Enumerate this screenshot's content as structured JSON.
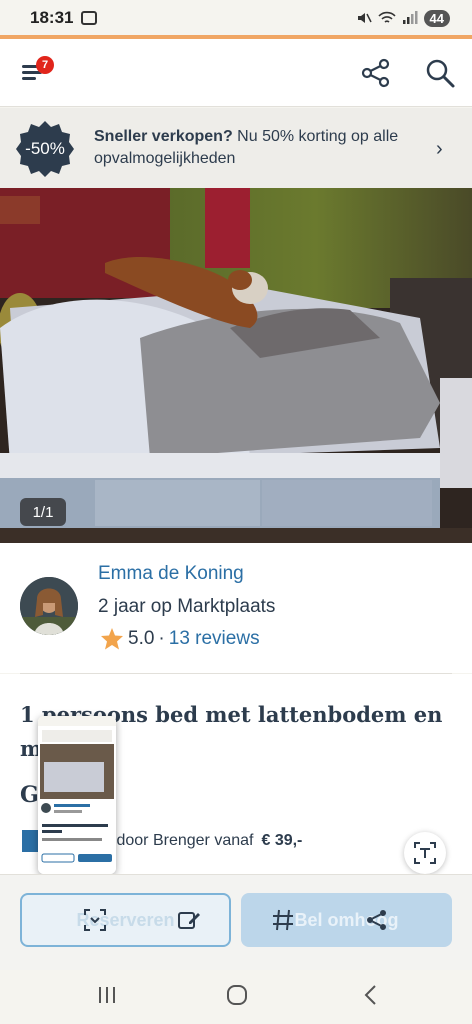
{
  "status": {
    "time": "18:31",
    "battery": "44"
  },
  "header": {
    "notification_count": "7"
  },
  "promo": {
    "badge": "-50%",
    "title": "Sneller verkopen?",
    "text": " Nu 50% korting op alle opvalmogelijkheden"
  },
  "gallery": {
    "counter": "1/1"
  },
  "seller": {
    "name": "Emma de Koning",
    "years": "2 jaar op Marktplaats",
    "rating": "5.0",
    "separator": "·",
    "reviews": "13 reviews"
  },
  "listing": {
    "title": "1 persoons bed met lattenbodem en matras",
    "price": "Gratis",
    "delivery": "Verzorgd door Brenger vanaf",
    "delivery_price": "€ 39,-"
  },
  "actions": {
    "reserve": "Reserveren",
    "call": "Bel omhoog"
  },
  "icons": {
    "menu": "menu-icon",
    "share": "share-icon",
    "search": "search-icon",
    "star": "star-icon",
    "text_scan": "text-scan-icon"
  },
  "colors": {
    "accent": "#f0a664",
    "link": "#2b6fa5",
    "badge": "#e1251b",
    "promo_badge": "#2d3c4d"
  }
}
